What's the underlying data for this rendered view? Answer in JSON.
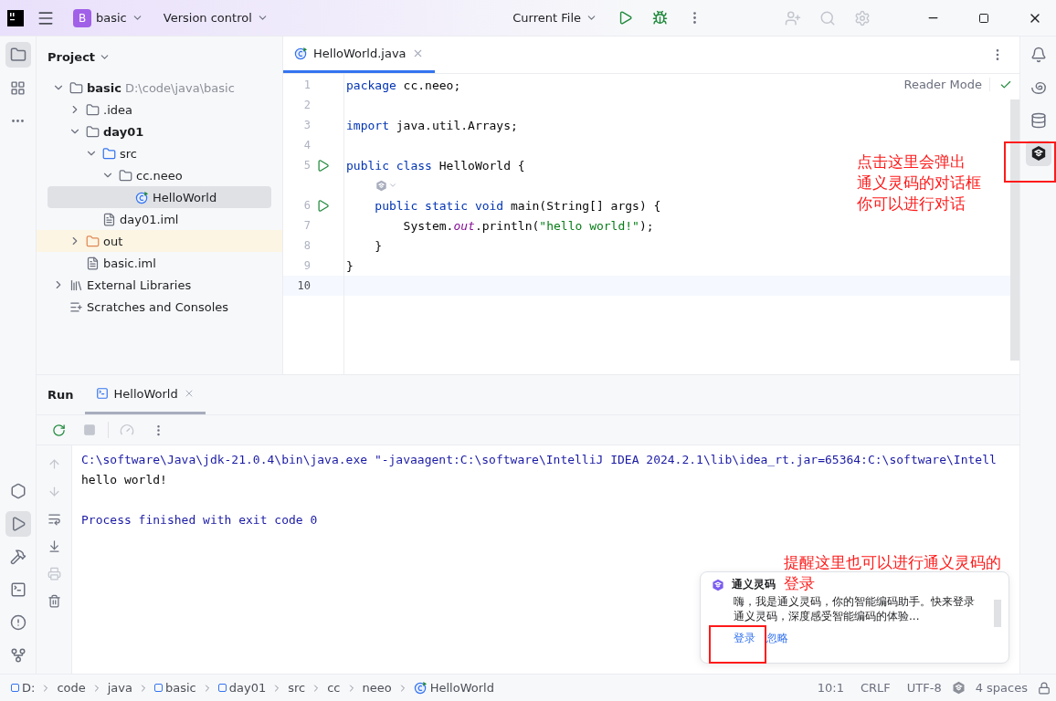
{
  "title_bar": {
    "project_letter": "B",
    "project_name": "basic",
    "vcs": "Version control",
    "run_config": "Current File"
  },
  "project_panel": {
    "title": "Project",
    "tree": [
      {
        "label": "basic",
        "path": "D:\\code\\java\\basic",
        "kind": "module",
        "expanded": true,
        "selected": false,
        "children": [
          {
            "label": ".idea",
            "kind": "folder",
            "expanded": false,
            "selected": false
          },
          {
            "label": "day01",
            "kind": "module",
            "expanded": true,
            "selected": false,
            "children": [
              {
                "label": "src",
                "kind": "source",
                "expanded": true,
                "selected": false,
                "children": [
                  {
                    "label": "cc.neeo",
                    "kind": "package",
                    "expanded": true,
                    "selected": false,
                    "children": [
                      {
                        "label": "HelloWorld",
                        "kind": "class",
                        "selected": true
                      }
                    ]
                  }
                ]
              },
              {
                "label": "day01.iml",
                "kind": "file",
                "selected": false
              }
            ]
          },
          {
            "label": "out",
            "kind": "excluded",
            "expanded": false,
            "selected": false
          },
          {
            "label": "basic.iml",
            "kind": "file",
            "selected": false
          }
        ]
      },
      {
        "label": "External Libraries",
        "kind": "library",
        "expanded": false,
        "selected": false
      },
      {
        "label": "Scratches and Consoles",
        "kind": "scratches",
        "selected": false
      }
    ]
  },
  "editor": {
    "tabs": [
      {
        "label": "HelloWorld.java",
        "selected": true
      }
    ],
    "reader_mode": "Reader Mode",
    "lines": [
      {
        "kind": "code",
        "number": "1",
        "run": false,
        "current": false,
        "tokens": [
          {
            "kind": "kw",
            "text": "package"
          },
          {
            "kind": "plain",
            "text": " cc.neeo;"
          }
        ]
      },
      {
        "kind": "code",
        "number": "2",
        "run": false,
        "current": false
      },
      {
        "kind": "code",
        "number": "3",
        "run": false,
        "current": false,
        "tokens": [
          {
            "kind": "kw",
            "text": "import"
          },
          {
            "kind": "plain",
            "text": " java.util.Arrays;"
          }
        ]
      },
      {
        "kind": "code",
        "number": "4",
        "run": false,
        "current": false
      },
      {
        "kind": "code",
        "number": "5",
        "run": true,
        "current": false,
        "tokens": [
          {
            "kind": "kw",
            "text": "public class"
          },
          {
            "kind": "plain",
            "text": " HelloWorld {"
          }
        ]
      },
      {
        "kind": "inlay"
      },
      {
        "kind": "code",
        "number": "6",
        "run": true,
        "current": false,
        "tokens": [
          {
            "kind": "kw",
            "text": "    public static void"
          },
          {
            "kind": "plain",
            "text": " main(String[] args) {"
          }
        ]
      },
      {
        "kind": "code",
        "number": "7",
        "run": false,
        "current": false,
        "tokens": [
          {
            "kind": "plain",
            "text": "        System."
          },
          {
            "kind": "field",
            "text": "out"
          },
          {
            "kind": "plain",
            "text": ".println("
          },
          {
            "kind": "str",
            "text": "\"hello world!\""
          },
          {
            "kind": "plain",
            "text": ");"
          }
        ]
      },
      {
        "kind": "code",
        "number": "8",
        "run": false,
        "current": false,
        "tokens": [
          {
            "kind": "plain",
            "text": "    }"
          }
        ]
      },
      {
        "kind": "code",
        "number": "9",
        "run": false,
        "current": false,
        "tokens": [
          {
            "kind": "plain",
            "text": "}"
          }
        ]
      },
      {
        "kind": "code",
        "number": "10",
        "run": false,
        "current": true
      }
    ]
  },
  "run_panel": {
    "title": "Run",
    "tabs": [
      {
        "label": "HelloWorld",
        "selected": true
      }
    ],
    "output": [
      {
        "kind": "command",
        "text": "C:\\software\\Java\\jdk-21.0.4\\bin\\java.exe \"-javaagent:C:\\software\\IntelliJ IDEA 2024.2.1\\lib\\idea_rt.jar=65364:C:\\software\\Intell"
      },
      {
        "kind": "output",
        "text": "hello world!"
      },
      {
        "kind": "blank"
      },
      {
        "kind": "info",
        "text": "Process finished with exit code 0"
      }
    ]
  },
  "notification": {
    "title": "通义灵码",
    "body": "嗨，我是通义灵码，你的智能编码助手。快来登录通义灵码，深度感受智能编码的体验...",
    "actions": [
      "登录",
      "忽略"
    ]
  },
  "status_bar": {
    "breadcrumbs": [
      {
        "label": "D:",
        "kind": "module"
      },
      {
        "label": "code",
        "kind": "dir"
      },
      {
        "label": "java",
        "kind": "dir"
      },
      {
        "label": "basic",
        "kind": "module"
      },
      {
        "label": "day01",
        "kind": "module"
      },
      {
        "label": "src",
        "kind": "dir"
      },
      {
        "label": "cc",
        "kind": "dir"
      },
      {
        "label": "neeo",
        "kind": "dir"
      },
      {
        "label": "HelloWorld",
        "kind": "class"
      }
    ],
    "position": "10:1",
    "line_separator": "CRLF",
    "encoding": "UTF-8",
    "indent": "4 spaces"
  },
  "annotations": [
    {
      "lines": [
        "点击这里会弹出",
        "通义灵码的对话框",
        "你可以进行对话"
      ]
    },
    {
      "lines": [
        "提醒这里也可以进行通义灵码的",
        "登录"
      ]
    }
  ]
}
